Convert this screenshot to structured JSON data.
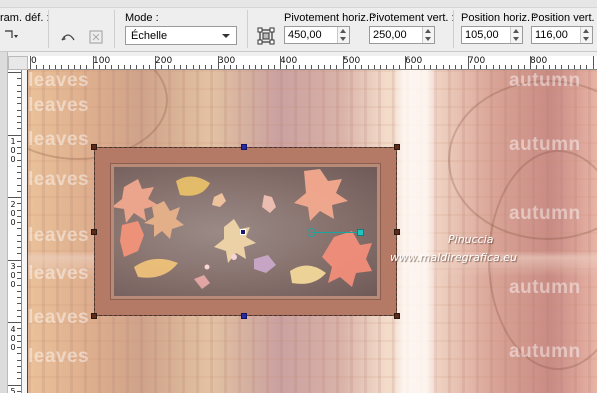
{
  "toolbar": {
    "frag_label": "ram. déf. :",
    "mode_label": "Mode :",
    "mode_value": "Échelle",
    "pivot_h_label": "Pivotement horiz. :",
    "pivot_h_value": "450,00",
    "pivot_v_label": "Pivotement vert. :",
    "pivot_v_value": "250,00",
    "pos_h_label": "Position horiz. :",
    "pos_h_value": "105,00",
    "pos_v_label": "Position vert. :",
    "pos_v_value": "116,00"
  },
  "ruler_h": [
    "0",
    "100",
    "200",
    "300",
    "400",
    "500",
    "600",
    "700",
    "800"
  ],
  "ruler_v": [
    "1",
    "0",
    "0",
    "2",
    "0",
    "0",
    "3",
    "0",
    "0",
    "4",
    "0",
    "0",
    "5"
  ],
  "canvas": {
    "watermarks": [
      "leaves",
      "leaves",
      "leaves",
      "leaves",
      "leaves",
      "leaves",
      "leaves",
      "leaves",
      "autumn",
      "autumn",
      "autumn",
      "autumn",
      "autumn"
    ],
    "signature_line1": "Pinuccia",
    "signature_line2": "www.maldiregrafica.eu"
  },
  "colors": {
    "handle_teal": "#21c3be",
    "frame_brown": "#b47a66",
    "selection_blue": "#2a3fc8"
  }
}
